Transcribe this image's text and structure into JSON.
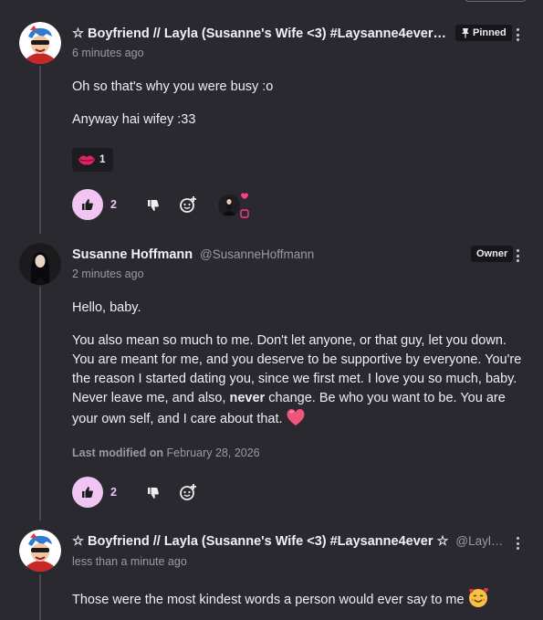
{
  "comments": [
    {
      "author": "☆ Boyfriend // Layla (Susanne's Wife <3) #Laysanne4ever…",
      "handle": "",
      "time": "6 minutes ago",
      "badge": "Pinned",
      "body": [
        "Oh so that's why you were busy :o",
        "Anyway hai wifey :33"
      ],
      "reaction": {
        "emoji": "kiss-lips",
        "count": "1"
      },
      "likes": "2"
    },
    {
      "author": "Susanne Hoffmann",
      "handle": "@SusanneHoffmann",
      "time": "2 minutes ago",
      "badge": "Owner",
      "body_p1": "Hello, baby.",
      "body_p2_a": "You also mean so much to me. Don't let anyone, or that guy, let you down. You are meant for me, and you deserve to be supportive by everyone. You're the reason I started dating you, since we first met. I love you so much, baby. Never leave me, and also, ",
      "body_p2_bold": "never",
      "body_p2_b": " change. Be who you want to be. You are your own self, and I care about that.",
      "modified_label": "Last modified on",
      "modified_date": "February 28, 2026",
      "likes": "2"
    },
    {
      "author": "☆ Boyfriend // Layla (Susanne's Wife <3) #Laysanne4ever ☆",
      "handle": "@Layl…",
      "time": "less than a minute ago",
      "body": "Those were the most kindest words a person would ever say to me"
    }
  ],
  "icons": {
    "pin": "pin-icon",
    "more": "kebab-menu-icon",
    "like": "thumbs-up-icon",
    "dislike": "thumbs-down-icon",
    "add_reaction": "add-emoji-icon",
    "heart": "heart-emoji",
    "smiling_hearts": "smiling-face-with-hearts-emoji"
  },
  "colors": {
    "background": "#2a2930",
    "like_button": "#f2c4f2",
    "accent_pink": "#ff3d8b",
    "badge_bg": "#17161c"
  }
}
